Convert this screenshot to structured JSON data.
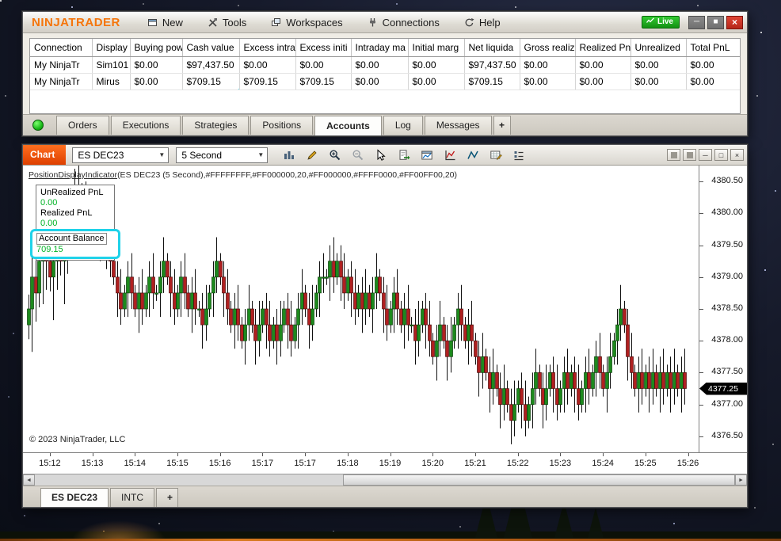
{
  "control_center": {
    "logo": "NINJATRADER",
    "menus": [
      {
        "label": "New",
        "icon": "new-window-icon"
      },
      {
        "label": "Tools",
        "icon": "tools-icon"
      },
      {
        "label": "Workspaces",
        "icon": "workspaces-icon"
      },
      {
        "label": "Connections",
        "icon": "connections-icon"
      },
      {
        "label": "Help",
        "icon": "help-icon"
      }
    ],
    "live_badge": "Live",
    "table": {
      "columns": [
        "Connection",
        "Display",
        "Buying pow",
        "Cash value",
        "Excess intra",
        "Excess initi",
        "Intraday ma",
        "Initial marg",
        "Net liquida",
        "Gross realiz",
        "Realized Pn",
        "Unrealized",
        "Total PnL"
      ],
      "rows": [
        [
          "My NinjaTr",
          "Sim101",
          "$0.00",
          "$97,437.50",
          "$0.00",
          "$0.00",
          "$0.00",
          "$0.00",
          "$97,437.50",
          "$0.00",
          "$0.00",
          "$0.00",
          "$0.00"
        ],
        [
          "My NinjaTr",
          "Mirus",
          "$0.00",
          "$709.15",
          "$709.15",
          "$709.15",
          "$0.00",
          "$0.00",
          "$709.15",
          "$0.00",
          "$0.00",
          "$0.00",
          "$0.00"
        ]
      ],
      "highlight": {
        "row": 1,
        "col": 3
      }
    },
    "tabs": [
      "Orders",
      "Executions",
      "Strategies",
      "Positions",
      "Accounts",
      "Log",
      "Messages"
    ],
    "active_tab": "Accounts",
    "add_tab": "+"
  },
  "chart_window": {
    "title": "Chart",
    "instrument_selector": "ES DEC23",
    "interval_selector": "5 Second",
    "indicator_name": "PositionDisplayIndicator",
    "indicator_params": "(ES DEC23 (5 Second),#FFFFFFFF,#FF000000,20,#FF000000,#FFFF0000,#FF00FF00,20)",
    "indicator_panel": {
      "unrealized_label": "UnRealized PnL",
      "unrealized_value": "0.00",
      "realized_label": "Realized PnL",
      "realized_value": "0.00",
      "balance_label": "Account Balance",
      "balance_value": "709.15"
    },
    "copyright": "© 2023 NinjaTrader, LLC",
    "tabs": [
      "ES DEC23",
      "INTC"
    ],
    "active_tab": "ES DEC23",
    "add_tab": "+"
  },
  "chart_data": {
    "type": "candlestick",
    "instrument": "ES DEC23",
    "interval": "5 Second",
    "first_open": 4378.25,
    "last_price": 4377.25,
    "last_price_label": "4377.25",
    "up_color": "#1d8a1d",
    "down_color": "#b02020",
    "y_ticks": [
      "4380.50",
      "4380.00",
      "4379.50",
      "4379.00",
      "4378.50",
      "4378.00",
      "4377.50",
      "4377.00",
      "4376.50"
    ],
    "y_min": 4376.25,
    "y_max": 4380.75,
    "x_labels": [
      "15:12",
      "15:13",
      "15:14",
      "15:15",
      "15:16",
      "15:17",
      "15:17",
      "15:18",
      "15:19",
      "15:20",
      "15:21",
      "15:22",
      "15:23",
      "15:24",
      "15:25",
      "15:26"
    ],
    "closes": [
      4378.5,
      4379,
      4378.75,
      4379.25,
      4379.5,
      4379.25,
      4379,
      4379.25,
      4379.5,
      4379.25,
      4379.5,
      4379.75,
      4380,
      4380.25,
      4380,
      4380.25,
      4380,
      4379.75,
      4380,
      4379.75,
      4379.5,
      4379.75,
      4379.5,
      4379.25,
      4379,
      4378.75,
      4378.5,
      4378.75,
      4379,
      4378.75,
      4378.5,
      4378.75,
      4378.5,
      4378.75,
      4379,
      4378.75,
      4378.75,
      4379,
      4379.25,
      4379,
      4378.75,
      4378.5,
      4378.75,
      4379,
      4378.75,
      4378.5,
      4378.75,
      4378.5,
      4378.5,
      4378.25,
      4378.5,
      4378.75,
      4379,
      4379.25,
      4379,
      4378.75,
      4378.5,
      4378.25,
      4378.5,
      4378.25,
      4378,
      4378.25,
      4378.5,
      4378.25,
      4378,
      4378.25,
      4378.5,
      4378.25,
      4378,
      4378.25,
      4378,
      4378.25,
      4378.5,
      4378.25,
      4378,
      4378.25,
      4378.5,
      4378.75,
      4378.5,
      4378.25,
      4378.5,
      4378.75,
      4379,
      4379,
      4379,
      4379.25,
      4379,
      4379.25,
      4379,
      4378.75,
      4379,
      4378.75,
      4378.5,
      4378.75,
      4378.5,
      4378.75,
      4378.5,
      4378.75,
      4379,
      4378.75,
      4378.5,
      4378.25,
      4378.5,
      4378.75,
      4378.5,
      4378.25,
      4378.5,
      4378.25,
      4378.25,
      4378,
      4378.25,
      4378.5,
      4378.25,
      4378,
      4377.75,
      4378,
      4378.25,
      4378,
      4377.75,
      4378,
      4378.25,
      4378.5,
      4378.25,
      4378,
      4378.25,
      4378,
      4377.75,
      4377.5,
      4377.75,
      4377.5,
      4377.25,
      4377.5,
      4377.25,
      4377,
      4377.25,
      4377,
      4376.75,
      4377,
      4377.25,
      4377,
      4376.75,
      4377,
      4377.25,
      4377.5,
      4377.25,
      4377,
      4377.25,
      4377.5,
      4377.25,
      4377,
      4377.25,
      4377.5,
      4377.25,
      4377.5,
      4377.25,
      4377,
      4377.25,
      4377.5,
      4377.25,
      4377.5,
      4377.75,
      4377.5,
      4377.25,
      4377.5,
      4377.75,
      4378,
      4378.25,
      4378.5,
      4378.25,
      4377.75,
      4377.5,
      4377.25,
      4377.5,
      4377.25,
      4377.5,
      4377.25,
      4377.5,
      4377.25,
      4377.5,
      4377.25,
      4377.5,
      4377.25,
      4377.5,
      4377.25,
      4377.5,
      4377.25
    ]
  }
}
